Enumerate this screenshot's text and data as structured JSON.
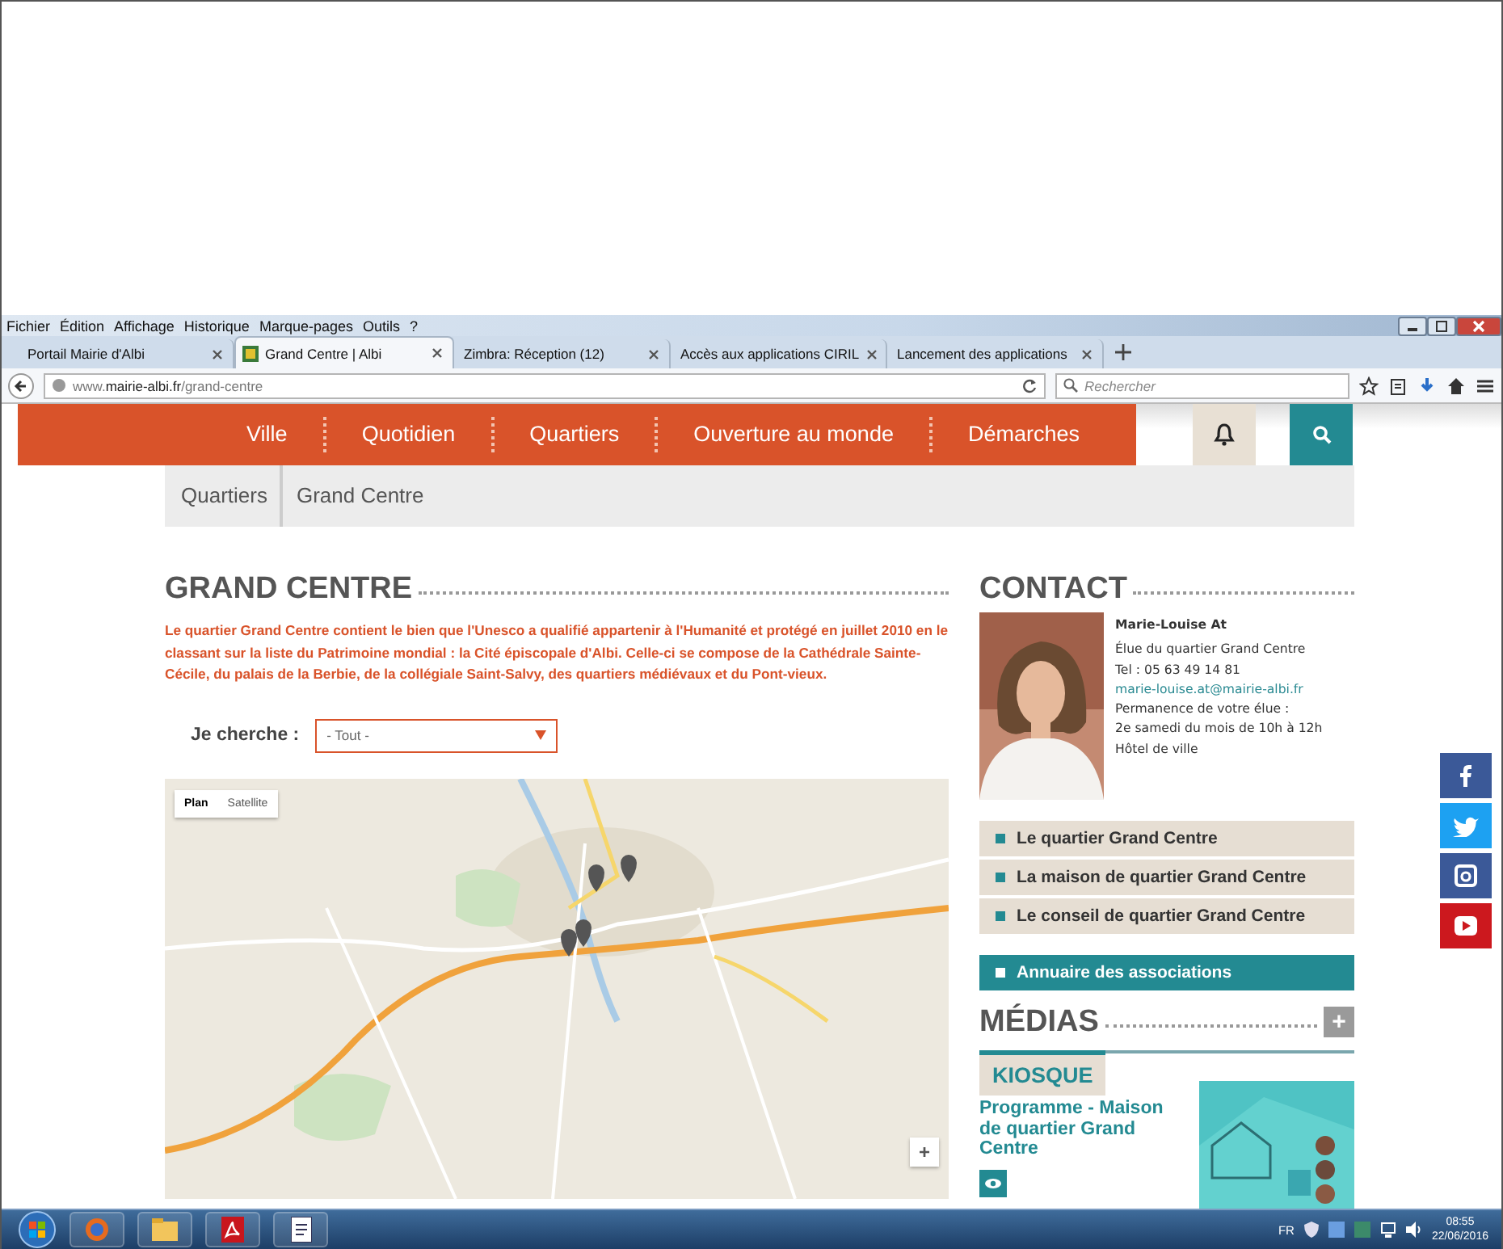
{
  "menu_bar": [
    "Fichier",
    "Édition",
    "Affichage",
    "Historique",
    "Marque-pages",
    "Outils",
    "?"
  ],
  "tabs": [
    {
      "label": "Portail Mairie d'Albi",
      "selected": false
    },
    {
      "label": "Grand Centre | Albi",
      "selected": true
    },
    {
      "label": "Zimbra: Réception (12)",
      "selected": false
    },
    {
      "label": "Accès aux applications CIRIL",
      "selected": false
    },
    {
      "label": "Lancement des applications",
      "selected": false
    }
  ],
  "address_bar": {
    "url": "www.**mairie-albi.fr**/grand-centre"
  },
  "search": {
    "placeholder": "Rechercher"
  },
  "nav": [
    "Ville",
    "Quotidien",
    "Quartiers",
    "Ouverture au monde",
    "Démarches"
  ],
  "breadcrumb": [
    "Quartiers",
    "Grand Centre"
  ],
  "main": {
    "title": "GRAND CENTRE",
    "intro": "Le quartier Grand Centre contient le bien que l'Unesco a qualifié appartenir à l'Humanité et protégé en juillet 2010 en le classant sur la liste du Patrimoine mondial : la Cité épiscopale d'Albi. Celle-ci se compose de la Cathédrale Sainte-Cécile, du palais de la Berbie, de la collégiale Saint-Salvy, des quartiers médiévaux et du Pont-vieux.",
    "filter_label": "Je cherche :",
    "filter_value": "- Tout -",
    "map": {
      "modes": [
        {
          "label": "Plan",
          "selected": true
        },
        {
          "label": "Satellite",
          "selected": false
        }
      ],
      "zoom": "+"
    }
  },
  "contact": {
    "title": "CONTACT",
    "name": "Marie-Louise At",
    "lines": [
      {
        "kind": "text",
        "text": "Élue du quartier Grand Centre"
      },
      {
        "kind": "text",
        "text": "Tel : 05 63 49 14 81"
      },
      {
        "kind": "link",
        "text": "marie-louise.at@mairie-albi.fr"
      },
      {
        "kind": "text",
        "text": "Permanence de votre élue :"
      },
      {
        "kind": "text",
        "text": "2e samedi du mois de 10h à 12h"
      },
      {
        "kind": "text",
        "text": "Hôtel de ville"
      }
    ]
  },
  "links": [
    {
      "kind": "beige",
      "label": "Le quartier Grand Centre"
    },
    {
      "kind": "beige",
      "label": "La maison de quartier Grand Centre"
    },
    {
      "kind": "beige",
      "label": "Le conseil de quartier Grand Centre"
    },
    {
      "kind": "teal",
      "label": "Annuaire des associations"
    }
  ],
  "medias": {
    "title": "MÉDIAS",
    "more": "+",
    "tab": "KIOSQUE",
    "item": "Programme - Maison de quartier Grand Centre"
  },
  "taskbar": {
    "language": "FR",
    "time": "08:55",
    "date": "22/06/2016"
  }
}
